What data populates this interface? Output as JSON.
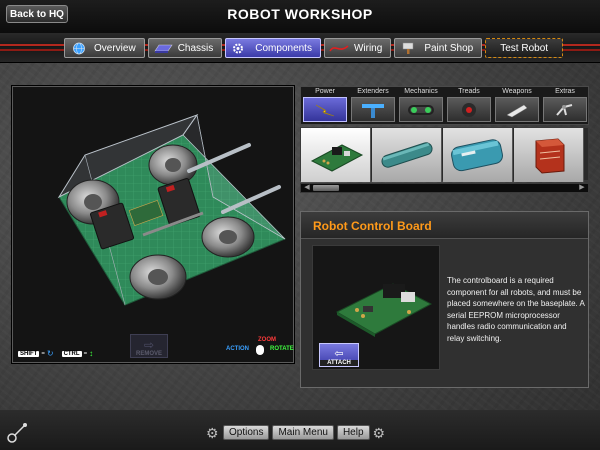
{
  "header": {
    "back_label": "Back to HQ",
    "title": "ROBOT WORKSHOP"
  },
  "tabs": [
    {
      "label": "Overview",
      "icon": "globe-icon",
      "active": false
    },
    {
      "label": "Chassis",
      "icon": "chassis-icon",
      "active": false
    },
    {
      "label": "Components",
      "icon": "gear-icon",
      "active": true
    },
    {
      "label": "Wiring",
      "icon": "wire-icon",
      "active": false
    },
    {
      "label": "Paint Shop",
      "icon": "paint-brush-icon",
      "active": false
    },
    {
      "label": "Test Robot",
      "icon": "",
      "active": false
    }
  ],
  "viewport": {
    "shift_key": "SHIFT",
    "ctrl_key": "CTRL",
    "remove_label": "REMOVE",
    "zoom_label": "ZOOM",
    "action_label": "ACTION",
    "rotate_label": "ROTATE"
  },
  "categories": [
    {
      "label": "Power",
      "icon": "lightning-icon",
      "active": true
    },
    {
      "label": "Extenders",
      "icon": "t-bar-icon",
      "active": false
    },
    {
      "label": "Mechanics",
      "icon": "gear-chain-icon",
      "active": false
    },
    {
      "label": "Treads",
      "icon": "wheel-icon",
      "active": false
    },
    {
      "label": "Weapons",
      "icon": "blade-icon",
      "active": false
    },
    {
      "label": "Extras",
      "icon": "claw-icon",
      "active": false
    }
  ],
  "parts": [
    {
      "name": "control-board",
      "selected": true
    },
    {
      "name": "pipe-battery",
      "selected": false
    },
    {
      "name": "cylinder-battery",
      "selected": false
    },
    {
      "name": "box-battery",
      "selected": false
    }
  ],
  "info": {
    "title": "Robot Control Board",
    "attach_label": "ATTACH",
    "description": "The controlboard is a required component for all robots, and must be placed somewhere on the baseplate. A serial EEPROM microprocessor handles radio communication and relay switching."
  },
  "footer": {
    "options_label": "Options",
    "main_menu_label": "Main Menu",
    "help_label": "Help"
  },
  "colors": {
    "accent_orange": "#ff9a1a",
    "active_tab": "#5a5acc",
    "baseplate_green": "#2f8a5a",
    "wire_red": "#b3281e"
  }
}
